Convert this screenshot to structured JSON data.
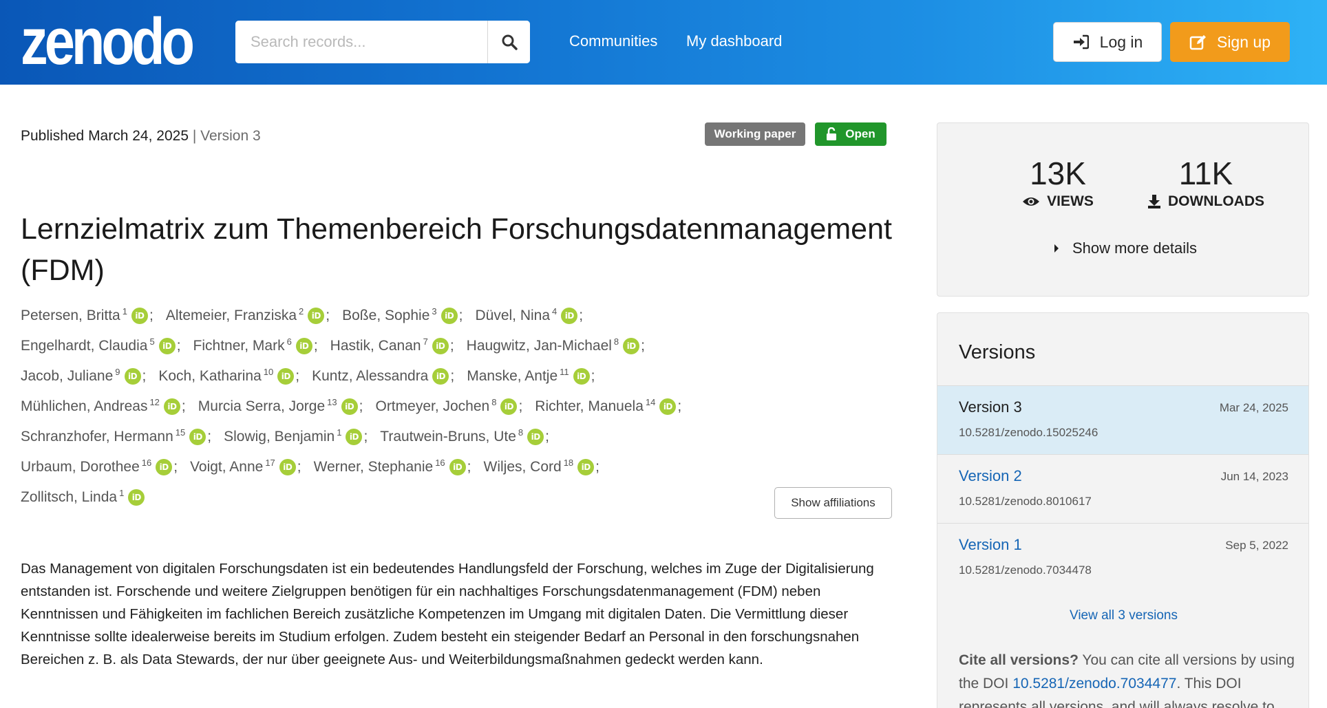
{
  "header": {
    "logo_text": "zenodo",
    "search": {
      "placeholder": "Search records...",
      "value": ""
    },
    "nav": {
      "communities": "Communities",
      "dashboard": "My dashboard"
    },
    "login_label": "Log in",
    "signup_label": "Sign up",
    "colors": {
      "header_start": "#0a57b7",
      "header_end": "#2eb2f6",
      "signup": "#f29b1b"
    }
  },
  "record": {
    "published": "Published March 24, 2025",
    "version_separator": " | ",
    "version_text": "Version 3",
    "resource_type": "Working paper",
    "access": "Open",
    "title": "Lernzielmatrix zum Themenbereich Forschungsdatenmanagement (FDM)",
    "authors": [
      [
        {
          "name": "Petersen, Britta",
          "sup": "1"
        },
        {
          "name": "Altemeier, Franziska",
          "sup": "2"
        },
        {
          "name": "Boße, Sophie",
          "sup": "3"
        },
        {
          "name": "Düvel, Nina",
          "sup": "4"
        }
      ],
      [
        {
          "name": "Engelhardt, Claudia",
          "sup": "5"
        },
        {
          "name": "Fichtner, Mark",
          "sup": "6"
        },
        {
          "name": "Hastik, Canan",
          "sup": "7"
        },
        {
          "name": "Haugwitz, Jan-Michael",
          "sup": "8"
        }
      ],
      [
        {
          "name": "Jacob, Juliane",
          "sup": "9"
        },
        {
          "name": "Koch, Katharina",
          "sup": "10"
        },
        {
          "name": "Kuntz, Alessandra",
          "sup": ""
        },
        {
          "name": "Manske, Antje",
          "sup": "11"
        }
      ],
      [
        {
          "name": "Mühlichen, Andreas",
          "sup": "12"
        },
        {
          "name": "Murcia Serra, Jorge",
          "sup": "13"
        },
        {
          "name": "Ortmeyer, Jochen",
          "sup": "8"
        },
        {
          "name": "Richter, Manuela",
          "sup": "14"
        }
      ],
      [
        {
          "name": "Schranzhofer, Hermann",
          "sup": "15"
        },
        {
          "name": "Slowig, Benjamin",
          "sup": "1"
        },
        {
          "name": "Trautwein-Bruns, Ute",
          "sup": "8"
        }
      ],
      [
        {
          "name": "Urbaum, Dorothee",
          "sup": "16"
        },
        {
          "name": "Voigt, Anne",
          "sup": "17"
        },
        {
          "name": "Werner, Stephanie",
          "sup": "16"
        },
        {
          "name": "Wiljes, Cord",
          "sup": "18"
        }
      ],
      [
        {
          "name": "Zollitsch, Linda",
          "sup": "1"
        }
      ]
    ],
    "orcid_glyph": "iD",
    "author_separator": ";",
    "show_affiliations": "Show affiliations",
    "description": "Das Management von digitalen Forschungsdaten ist ein bedeutendes Handlungsfeld der Forschung, welches im Zuge der Digitalisierung entstanden ist. Forschende und weitere Zielgruppen benötigen für ein nachhaltiges Forschungsdatenmanagement (FDM) neben Kenntnissen und Fähigkeiten im fachlichen Bereich zusätzliche Kompetenzen im Umgang mit digitalen Daten. Die Vermittlung dieser Kenntnisse sollte idealerweise bereits im Studium erfolgen. Zudem besteht ein steigender Bedarf an Personal in den forschungsnahen Bereichen z. B. als Data Stewards, der nur über geeignete Aus- und Weiterbildungsmaßnahmen gedeckt werden kann."
  },
  "stats": {
    "views_value": "13K",
    "views_label": "VIEWS",
    "downloads_value": "11K",
    "downloads_label": "DOWNLOADS",
    "show_more": "Show more details"
  },
  "versions": {
    "title": "Versions",
    "items": [
      {
        "name": "Version 3",
        "date": "Mar 24, 2025",
        "doi": "10.5281/zenodo.15025246",
        "active": true
      },
      {
        "name": "Version 2",
        "date": "Jun 14, 2023",
        "doi": "10.5281/zenodo.8010617",
        "active": false
      },
      {
        "name": "Version 1",
        "date": "Sep 5, 2022",
        "doi": "10.5281/zenodo.7034478",
        "active": false
      }
    ],
    "view_all": "View all 3 versions",
    "cite_all_bold": "Cite all versions?",
    "cite_all_text": " You can cite all versions by using the DOI ",
    "cite_all_doi": "10.5281/zenodo.7034477",
    "cite_all_tail": ". This DOI represents all versions, and will always resolve to the latest one."
  }
}
